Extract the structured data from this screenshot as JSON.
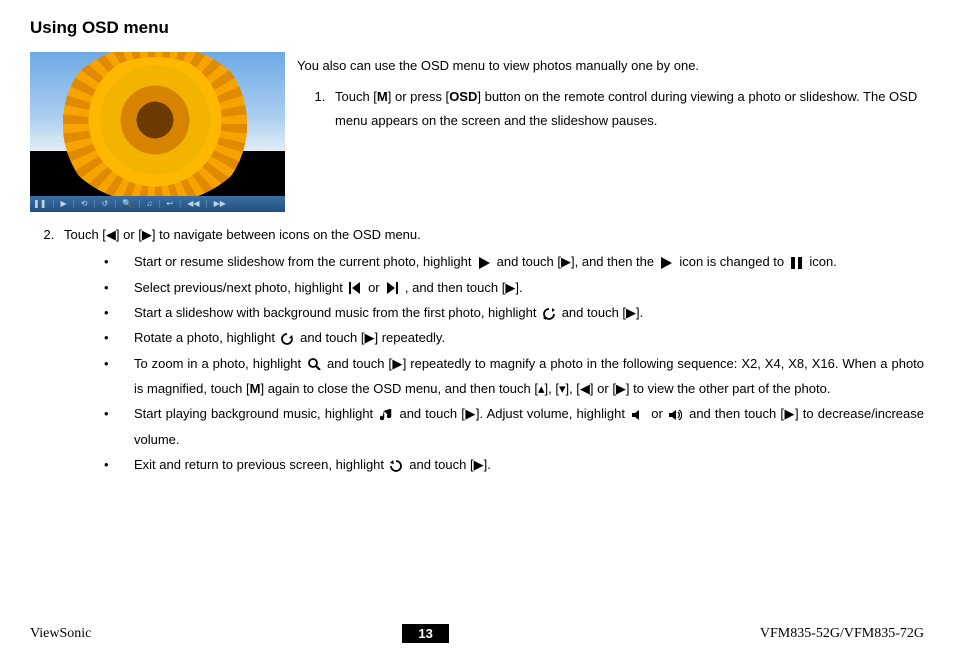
{
  "heading": "Using OSD menu",
  "intro": "You also can use the OSD menu to view photos manually one by one.",
  "step1": {
    "pre": "Touch [",
    "m": "M",
    "mid1": "] or press [",
    "osd": "OSD",
    "post": "] button on the remote control during viewing a photo or slideshow. The OSD menu appears on the screen and the slideshow pauses."
  },
  "step2_lead": "Touch [◀] or [▶] to navigate between icons on the OSD menu.",
  "b1": {
    "a": "Start or resume slideshow from the current photo, highlight ",
    "b": " and touch [▶], and then the ",
    "c": " icon is changed to ",
    "d": " icon."
  },
  "b2": {
    "a": "Select previous/next photo, highlight ",
    "b": " or ",
    "c": " , and then touch [▶]."
  },
  "b3": {
    "a": "Start a slideshow with background music from the first photo, highlight ",
    "b": " and touch [▶]."
  },
  "b4": {
    "a": "Rotate a photo, highlight ",
    "b": " and touch [▶] repeatedly."
  },
  "b5": {
    "a": "To zoom in a photo, highlight ",
    "b": " and touch [▶] repeatedly to magnify a photo in the following sequence: X2, X4, X8, X16. When a photo is magnified, touch [",
    "m": "M",
    "c": "] again to close the OSD menu, and then touch [▴], [▾], [◀] or [▶] to view the other part of the photo."
  },
  "b6": {
    "a": "Start playing background music, highlight ",
    "b": " and touch [▶]. Adjust volume, highlight ",
    "c": " or ",
    "d": " and then touch [▶] to decrease/increase volume."
  },
  "b7": {
    "a": "Exit and return to previous screen, highlight ",
    "b": " and touch [▶]."
  },
  "footer_left": "ViewSonic",
  "footer_page": "13",
  "footer_right": "VFM835-52G/VFM835-72G"
}
